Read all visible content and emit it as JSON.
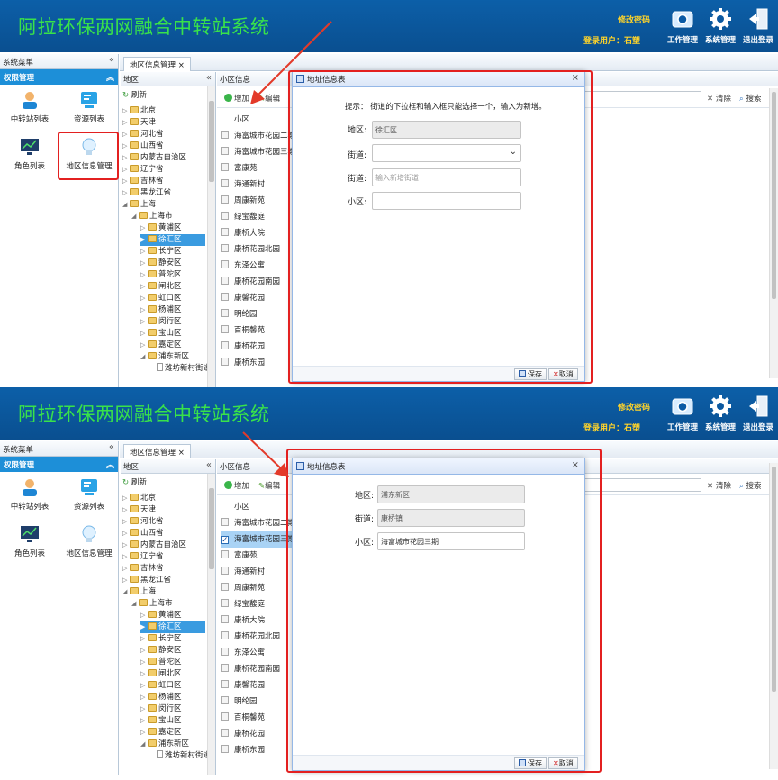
{
  "app": {
    "title": "阿拉环保两网融合中转站系统",
    "change_password": "修改密码",
    "user_label": "登录用户：石塑",
    "buttons": [
      "工作管理",
      "系统管理",
      "退出登录"
    ]
  },
  "sidebar": {
    "header": "系统菜单",
    "section": "权限管理",
    "items": [
      "中转站列表",
      "资源列表",
      "角色列表",
      "地区信息管理"
    ]
  },
  "tab": {
    "label": "地区信息管理",
    "close": "×"
  },
  "tree": {
    "header": "地区",
    "refresh": "刷新",
    "nodes": [
      "北京",
      "天津",
      "河北省",
      "山西省",
      "内蒙古自治区",
      "辽宁省",
      "吉林省",
      "黑龙江省",
      "上海",
      "上海市",
      "黄浦区",
      "徐汇区",
      "长宁区",
      "静安区",
      "普陀区",
      "闸北区",
      "虹口区",
      "杨浦区",
      "闵行区",
      "宝山区",
      "嘉定区",
      "浦东新区",
      "潍坊新村街道"
    ]
  },
  "list": {
    "header": "小区信息",
    "add": "增加",
    "edit": "编辑",
    "clear": "清除",
    "search": "搜索",
    "column": "小区",
    "rows": [
      "海富城市花园二期",
      "海富城市花园三期",
      "富康苑",
      "海通新村",
      "周康新苑",
      "绿宝馥庭",
      "康桥大院",
      "康桥花园北园",
      "东泽公寓",
      "康桥花园南园",
      "康馨花园",
      "明纶园",
      "百桐馨苑",
      "康桥花园",
      "康桥东园"
    ]
  },
  "dialog1": {
    "title": "地址信息表",
    "tip": "提示：  街道的下拉框和输入框只能选择一个，输入为新增。",
    "region_label": "地区:",
    "region_value": "徐汇区",
    "street_label": "街道:",
    "street_label2": "街道:",
    "street_placeholder": "输入新增街道",
    "community_label": "小区:",
    "save": "保存",
    "cancel": "取消"
  },
  "dialog2": {
    "title": "地址信息表",
    "region_label": "地区:",
    "region_value": "浦东新区",
    "street_label": "街道:",
    "street_value": "康桥镇",
    "community_label": "小区:",
    "community_value": "海富城市花园三期",
    "save": "保存",
    "cancel": "取消"
  }
}
